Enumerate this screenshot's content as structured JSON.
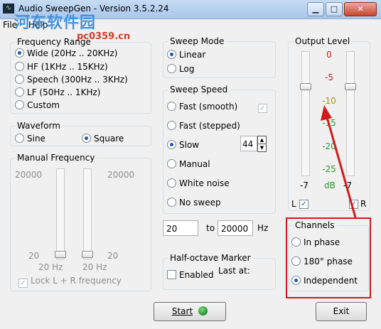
{
  "window": {
    "title": "Audio SweepGen - Version 3.5.2.24",
    "app_icon": "waveform-icon",
    "minimize": "▁",
    "maximize": "□",
    "close": "✕"
  },
  "menu": {
    "file": "File",
    "help": "Help"
  },
  "watermark": {
    "main": "河东软件园",
    "sub": "pc0359.cn"
  },
  "frequency_range": {
    "title": "Frequency Range",
    "options": [
      {
        "label": "Wide  (20Hz .. 20KHz)",
        "selected": true
      },
      {
        "label": "HF  (1KHz .. 15KHz)",
        "selected": false
      },
      {
        "label": "Speech  (300Hz .. 3KHz)",
        "selected": false
      },
      {
        "label": "LF  (50Hz .. 1KHz)",
        "selected": false
      },
      {
        "label": "Custom",
        "selected": false
      }
    ]
  },
  "waveform": {
    "title": "Waveform",
    "sine": "Sine",
    "square": "Square",
    "selected": "Square"
  },
  "manual_frequency": {
    "title": "Manual Frequency",
    "left_max": "20000",
    "right_max": "20000",
    "left_min": "20",
    "right_min": "20",
    "left_value": "20 Hz",
    "right_value": "20 Hz",
    "lock_label": "Lock L + R frequency",
    "lock_checked": true
  },
  "sweep_mode": {
    "title": "Sweep Mode",
    "linear": "Linear",
    "log": "Log",
    "selected": "Linear"
  },
  "sweep_speed": {
    "title": "Sweep Speed",
    "options": [
      {
        "label": "Fast (smooth)",
        "selected": false
      },
      {
        "label": "Fast (stepped)",
        "selected": false
      },
      {
        "label": "Slow",
        "selected": true
      },
      {
        "label": "Manual",
        "selected": false
      },
      {
        "label": "White noise",
        "selected": false
      },
      {
        "label": "No sweep",
        "selected": false
      }
    ],
    "smooth_checkbox_checked": true,
    "slow_value": "44"
  },
  "range": {
    "from": "20",
    "to_label": "to",
    "to": "20000",
    "unit": "Hz"
  },
  "half_octave": {
    "title": "Half-octave Marker",
    "enabled": "Enabled",
    "last_at": "Last at:",
    "enabled_checked": false
  },
  "output_level": {
    "title": "Output Level",
    "scale": [
      "0",
      "-5",
      "-10",
      "-15",
      "-20",
      "-25"
    ],
    "scale_colors": [
      "#d11a1a",
      "#d11a1a",
      "#a09014",
      "#2a9a2a",
      "#2a9a2a",
      "#2a9a2a"
    ],
    "left_value": "-7",
    "unit": "dB",
    "right_value": "-7",
    "left_label": "L",
    "right_label": "R",
    "left_checked": true,
    "right_checked": true
  },
  "channels": {
    "title": "Channels",
    "options": [
      {
        "label": "In phase",
        "selected": false
      },
      {
        "label": "180° phase",
        "selected": false
      },
      {
        "label": "Independent",
        "selected": true
      }
    ]
  },
  "buttons": {
    "start": "Start",
    "exit": "Exit"
  }
}
